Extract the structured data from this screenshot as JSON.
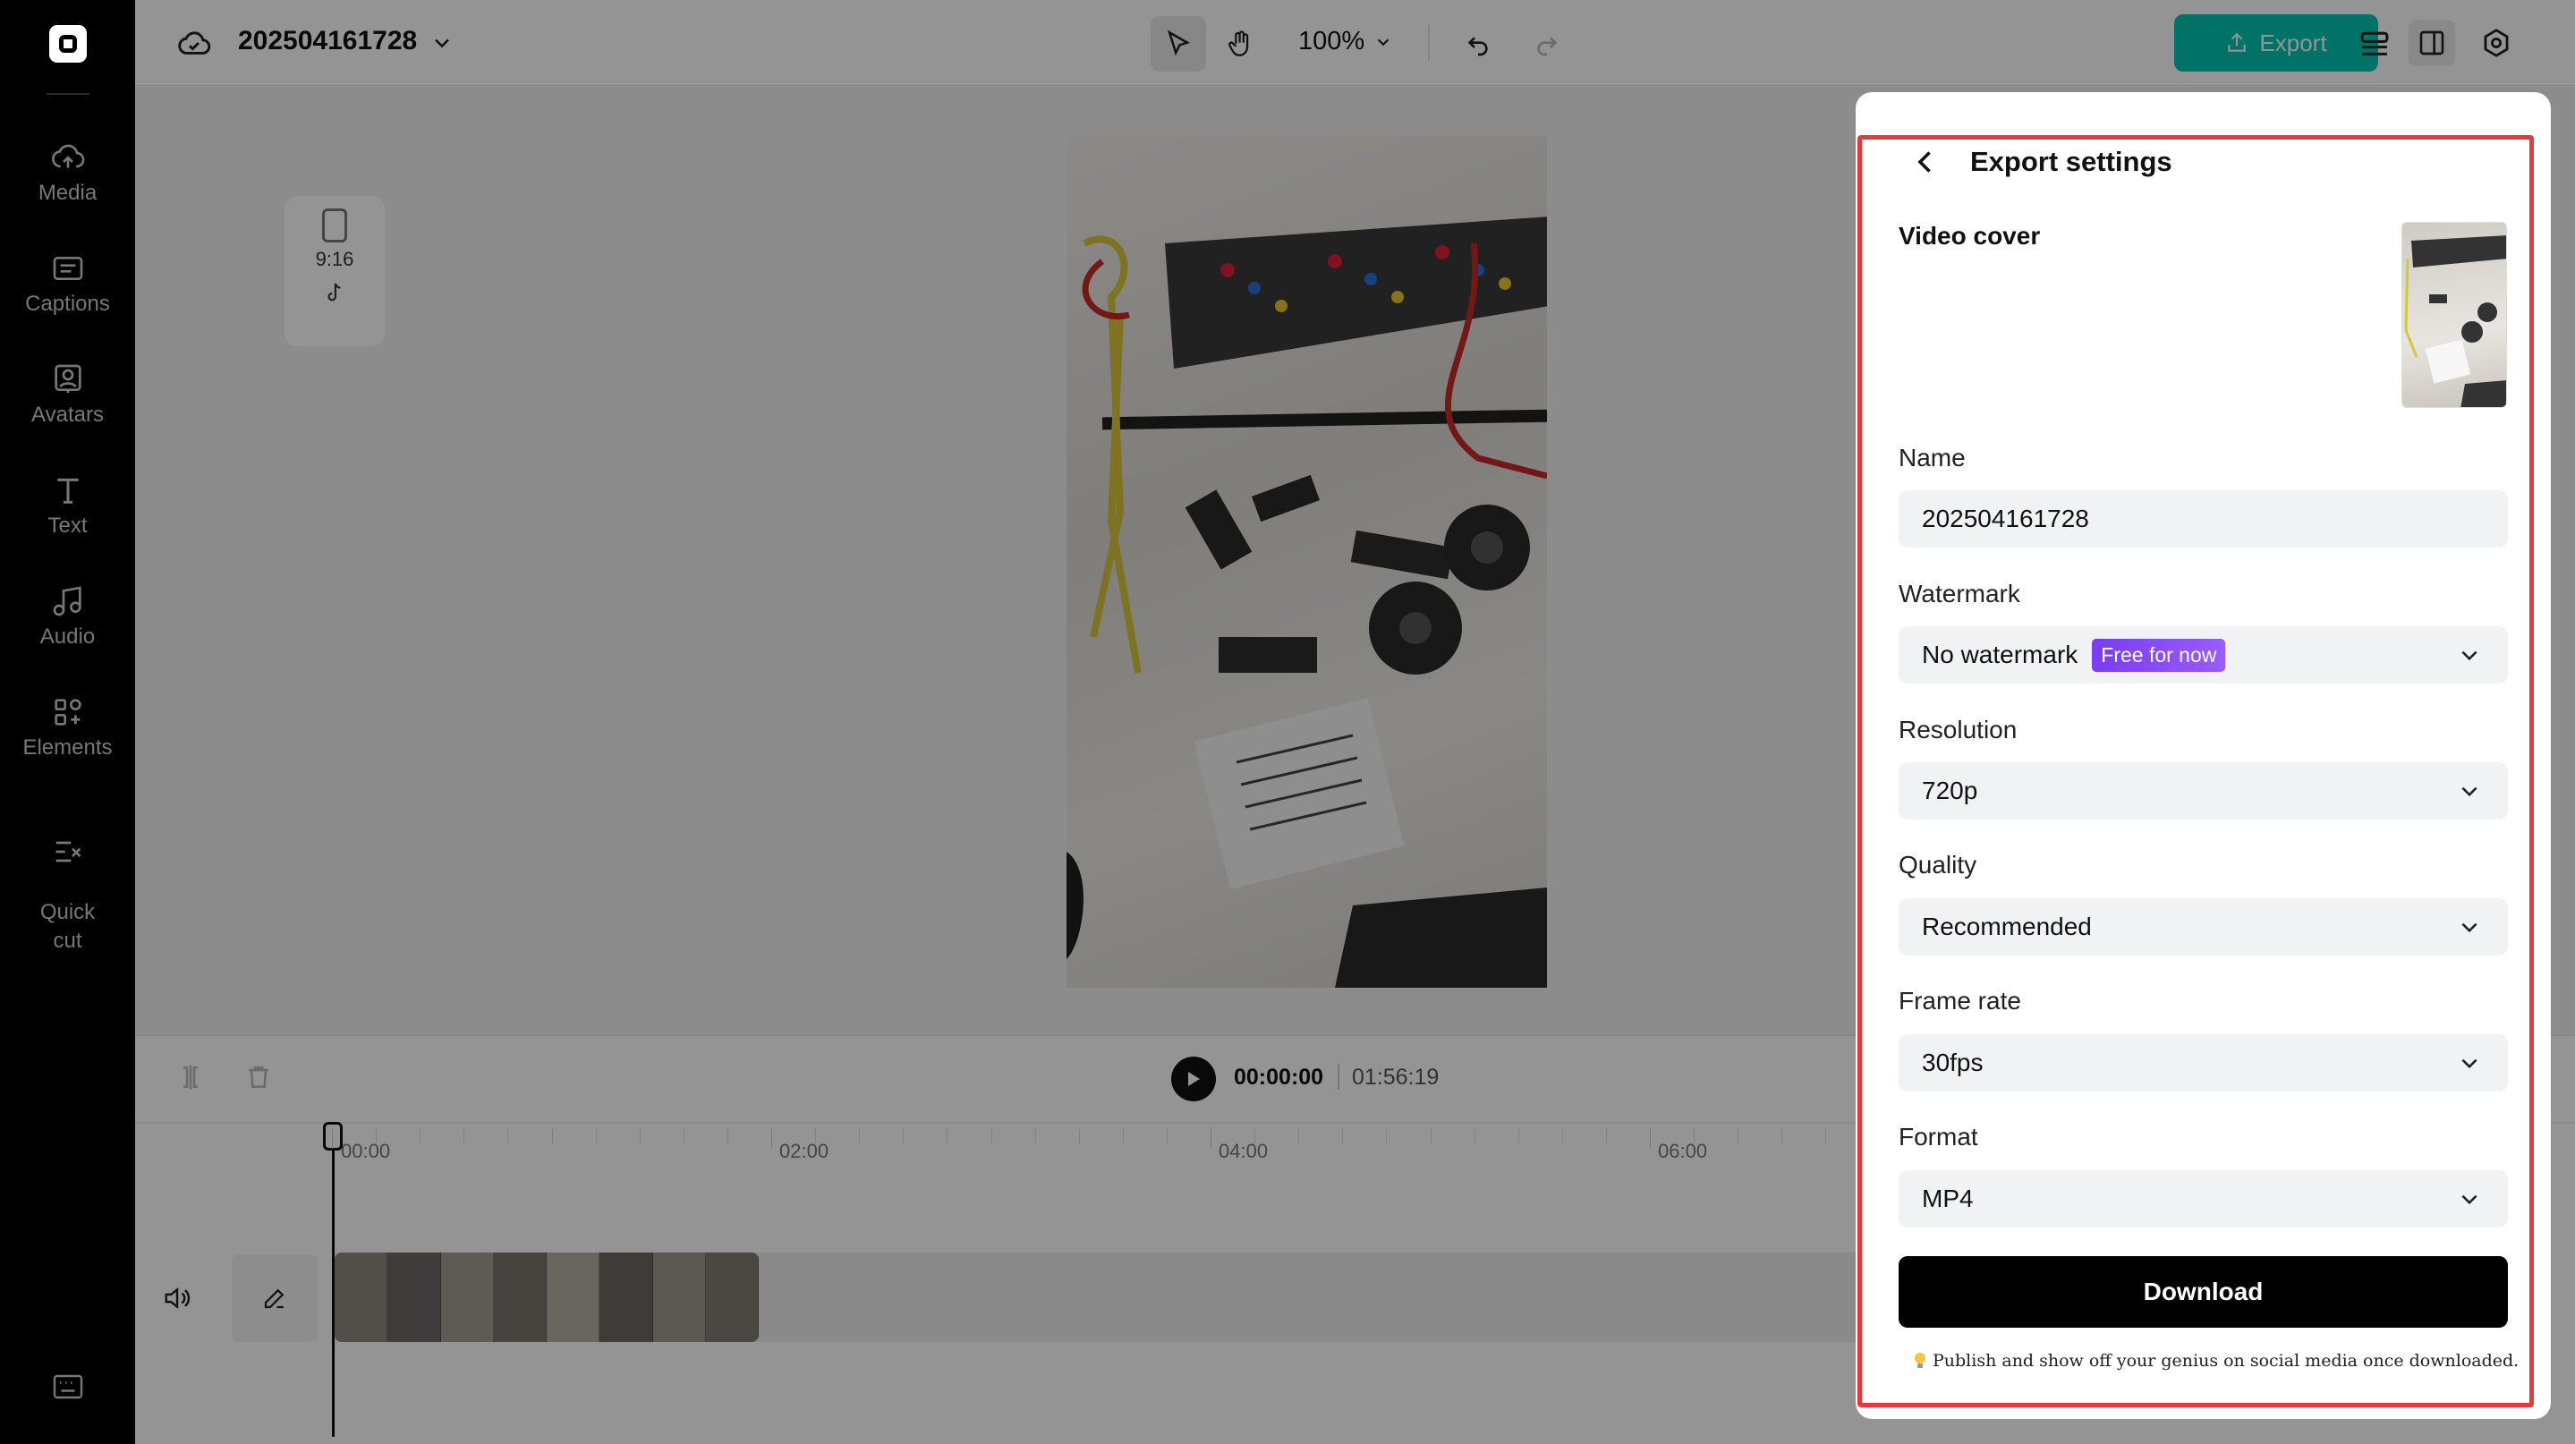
{
  "project": {
    "name": "202504161728"
  },
  "toolbar": {
    "zoom": "100%",
    "export_label": "Export"
  },
  "sidebar": {
    "items": [
      {
        "label": "Media",
        "icon": "cloud-upload-icon"
      },
      {
        "label": "Captions",
        "icon": "captions-icon"
      },
      {
        "label": "Avatars",
        "icon": "avatar-icon"
      },
      {
        "label": "Text",
        "icon": "text-icon"
      },
      {
        "label": "Audio",
        "icon": "music-note-icon"
      },
      {
        "label": "Elements",
        "icon": "elements-icon"
      },
      {
        "label": "Quick\ncut",
        "icon": "quick-cut-icon"
      }
    ]
  },
  "canvas": {
    "aspect_ratio": "9:16"
  },
  "timeline": {
    "current_time": "00:00:00",
    "total_time": "01:56:19",
    "ruler_labels": [
      "00:00",
      "02:00",
      "04:00",
      "06:00"
    ]
  },
  "export_panel": {
    "title": "Export settings",
    "video_cover_label": "Video cover",
    "name_label": "Name",
    "name_value": "202504161728",
    "watermark_label": "Watermark",
    "watermark_value": "No watermark",
    "watermark_badge": "Free for now",
    "resolution_label": "Resolution",
    "resolution_value": "720p",
    "quality_label": "Quality",
    "quality_value": "Recommended",
    "frame_rate_label": "Frame rate",
    "frame_rate_value": "30fps",
    "format_label": "Format",
    "format_value": "MP4",
    "download_label": "Download",
    "note": "Publish and show off your genius on social media once downloaded."
  },
  "colors": {
    "accent": "#00c5b4",
    "badge": "#7a3cf5",
    "highlight": "#e5393f"
  }
}
